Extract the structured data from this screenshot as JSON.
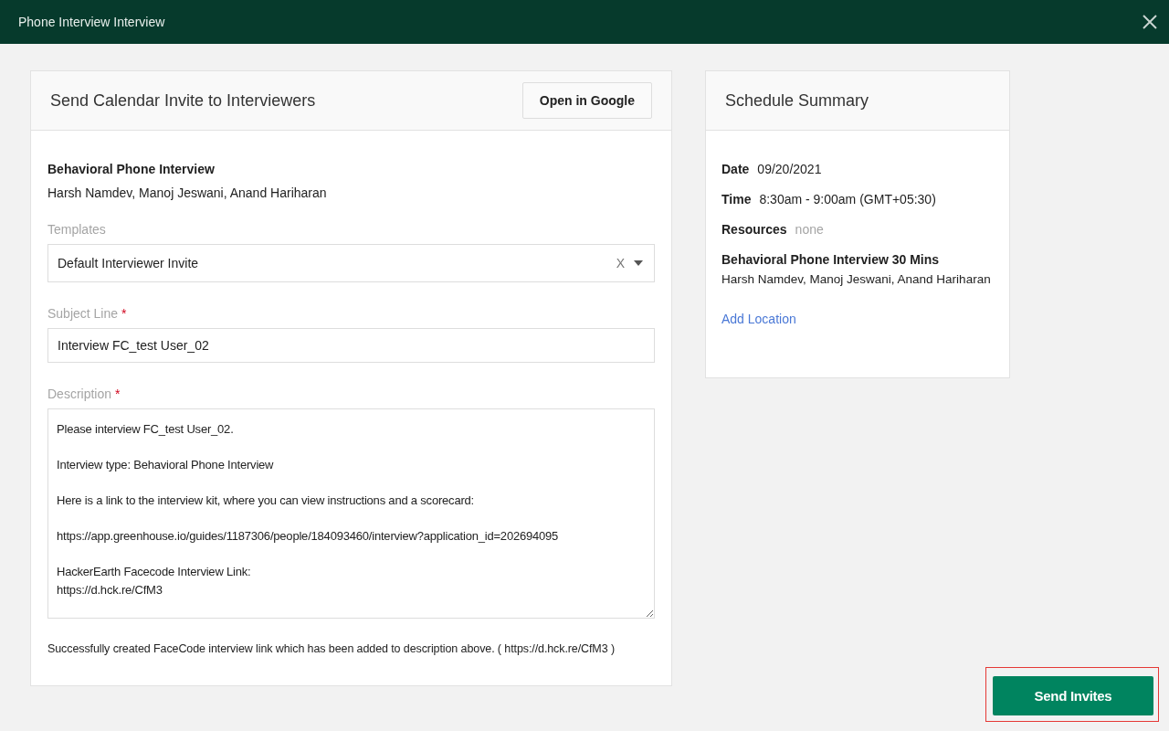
{
  "window": {
    "title": "Phone Interview Interview"
  },
  "invite": {
    "title": "Send Calendar Invite to Interviewers",
    "open_button": "Open in Google",
    "interview_name": "Behavioral Phone Interview",
    "interviewers": "Harsh Namdev, Manoj Jeswani, Anand Hariharan",
    "templates": {
      "label": "Templates",
      "value": "Default Interviewer Invite",
      "clear": "X"
    },
    "subject": {
      "label": "Subject Line",
      "required_mark": "*",
      "value": "Interview FC_test User_02"
    },
    "description": {
      "label": "Description",
      "required_mark": "*",
      "value": "Please interview FC_test User_02.\n\nInterview type: Behavioral Phone Interview\n\nHere is a link to the interview kit, where you can view instructions and a scorecard:\n\nhttps://app.greenhouse.io/guides/1187306/people/184093460/interview?application_id=202694095\n\nHackerEarth Facecode Interview Link:\nhttps://d.hck.re/CfM3"
    },
    "status_message": "Successfully created FaceCode interview link which has been added to description above. ( https://d.hck.re/CfM3 )"
  },
  "summary": {
    "title": "Schedule Summary",
    "fields": [
      {
        "label": "Date",
        "value": "09/20/2021",
        "muted": false
      },
      {
        "label": "Time",
        "value": "8:30am - 9:00am (GMT+05:30)",
        "muted": false
      },
      {
        "label": "Resources",
        "value": "none",
        "muted": true
      }
    ],
    "interview_name": "Behavioral Phone Interview 30 Mins",
    "interviewers": "Harsh Namdev, Manoj Jeswani, Anand Hariharan",
    "add_location": "Add Location"
  },
  "send_button": {
    "label": "Send Invites",
    "highlighted": true
  }
}
